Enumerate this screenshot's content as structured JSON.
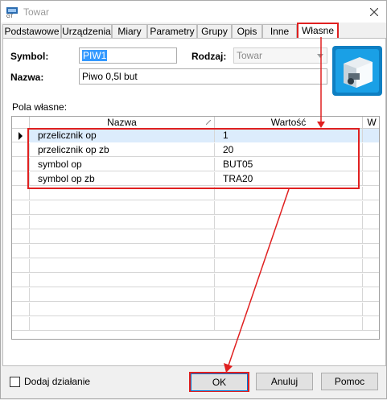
{
  "window": {
    "title": "Towar"
  },
  "tabs": [
    {
      "label": "Podstawowe"
    },
    {
      "label": "Urządzenia"
    },
    {
      "label": "Miary"
    },
    {
      "label": "Parametry"
    },
    {
      "label": "Grupy"
    },
    {
      "label": "Opis"
    },
    {
      "label": "Inne"
    },
    {
      "label": "Własne"
    }
  ],
  "active_tab": "Własne",
  "form": {
    "symbol_label": "Symbol:",
    "symbol_value": "PIW1",
    "rodzaj_label": "Rodzaj:",
    "rodzaj_value": "Towar",
    "nazwa_label": "Nazwa:",
    "nazwa_value": "Piwo 0,5l but"
  },
  "custom_fields": {
    "section_label": "Pola własne:",
    "columns": [
      "Nazwa",
      "Wartość",
      "W"
    ],
    "rows": [
      {
        "nazwa": "przelicznik op",
        "wartosc": "1"
      },
      {
        "nazwa": "przelicznik op zb",
        "wartosc": "20"
      },
      {
        "nazwa": "symbol op",
        "wartosc": "BUT05"
      },
      {
        "nazwa": "symbol op zb",
        "wartosc": "TRA20"
      }
    ]
  },
  "footer": {
    "add_action_label": "Dodaj działanie",
    "ok_label": "OK",
    "cancel_label": "Anuluj",
    "help_label": "Pomoc"
  },
  "colors": {
    "annotation": "#e02020",
    "selection": "#3399ff",
    "row_highlight": "#dcecfc"
  },
  "icons": [
    "app-icon",
    "close-icon",
    "dropdown-arrow-icon",
    "product-image",
    "row-indicator-icon",
    "sort-icon"
  ]
}
